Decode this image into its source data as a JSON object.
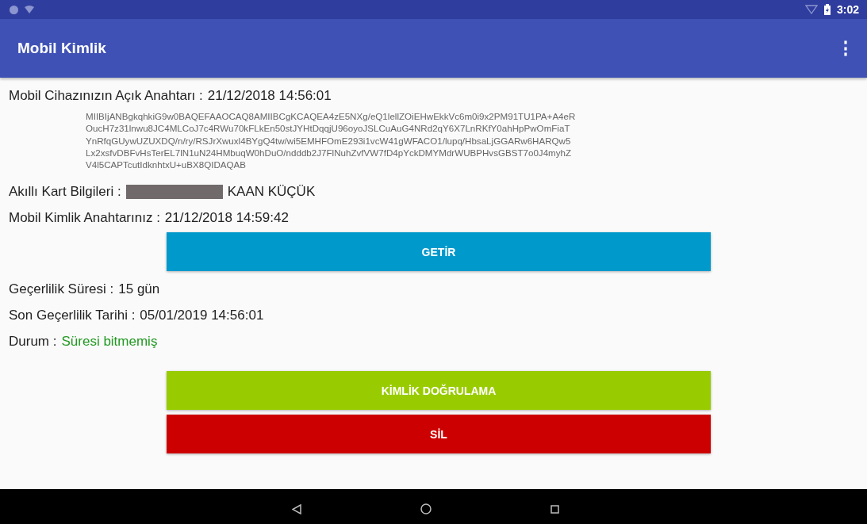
{
  "status_bar": {
    "time": "3:02"
  },
  "app_bar": {
    "title": "Mobil Kimlik",
    "menu": "⋮"
  },
  "public_key": {
    "label": "Mobil Cihazınızın Açık Anahtarı :",
    "date": "21/12/2018 14:56:01",
    "lines": [
      "MIIBIjANBgkqhkiG9w0BAQEFAAOCAQ8AMIIBCgKCAQEA4zE5NXg/eQ1lellZOiEHwEkkVc6m0i9x2PM91TU1PA+A4eR",
      "OucH7z31lnwu8JC4MLCoJ7c4RWu70kFLkEn50stJYHtDqqjU96oyoJSLCuAuG4NRd2qY6X7LnRKfY0ahHpPwOmFiaT",
      "YnRfqGUywUZUXDQ/n/ry/RSJrXwuxl4BYgQ4tw/wi5EMHFOmE293i1vcW41gWFACO1/lupq/HbsaLjGGARw6HARQw5",
      "Lx2xsfvDBFvHsTerEL7lN1uN24HMbuqW0hDuO/ndddb2J7FlNuhZvfVW7fD4pYckDMYMdrWUBPHvsGBST7o0J4myhZ",
      "V4l5CAPTcutIdknhtxU+uBX8QIDAQAB"
    ]
  },
  "card": {
    "label": "Akıllı Kart Bilgileri :",
    "name": "KAAN KÜÇÜK"
  },
  "identity_key": {
    "label": "Mobil Kimlik Anahtarınız :",
    "date": "21/12/2018 14:59:42"
  },
  "fetch_button": {
    "label": "GETİR",
    "color": "#0099cc"
  },
  "fields": [
    {
      "label": "Geçerlilik Süresi :",
      "value": "15 gün",
      "kind": "plain"
    },
    {
      "label": "Son Geçerlilik Tarihi :",
      "value": "05/01/2019 14:56:01",
      "kind": "plain"
    },
    {
      "label": "Durum :",
      "value": "Süresi bitmemiş",
      "kind": "ok"
    }
  ],
  "buttons": [
    {
      "label": "KİMLİK DOĞRULAMA",
      "color": "#99cc00"
    },
    {
      "label": "SİL",
      "color": "#cc0000"
    }
  ]
}
